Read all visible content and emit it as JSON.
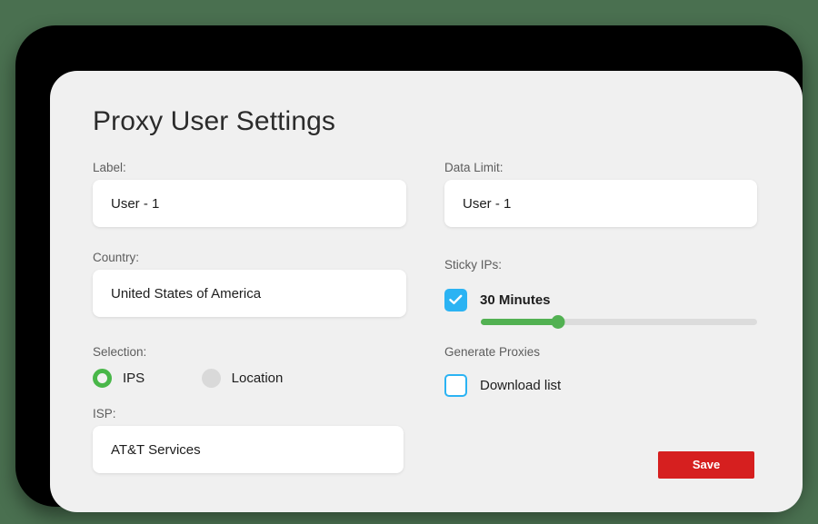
{
  "theme": {
    "page_background": "#4a7050",
    "bezel_color": "#000000",
    "panel_background": "#f0f0f0",
    "accent_green": "#52b152",
    "accent_blue": "#2bb3f3",
    "save_red": "#d61f1f",
    "input_background": "#ffffff",
    "label_color": "#5d5d5d",
    "value_color": "#1d1d1d"
  },
  "title": "Proxy User Settings",
  "left_column": {
    "label_field": {
      "label": "Label:",
      "value": "User - 1",
      "placeholder": "User - 1"
    },
    "country_field": {
      "label": "Country:",
      "value": "United States of America",
      "placeholder": "United States of America"
    },
    "selection": {
      "label": "Selection:",
      "options": [
        {
          "label": "IPS",
          "selected": true
        },
        {
          "label": "Location",
          "selected": false
        }
      ]
    },
    "isp_field": {
      "label": "ISP:",
      "value": "AT&T Services",
      "placeholder": "AT&T Services"
    }
  },
  "right_column": {
    "data_limit_field": {
      "label": "Data Limit:",
      "value": "User - 1",
      "placeholder": "User - 1"
    },
    "sticky_ips": {
      "label": "Sticky IPs:",
      "checkbox_checked": true,
      "duration_text": "30 Minutes",
      "slider": {
        "percent": 28,
        "min": 0,
        "max": 100
      }
    },
    "generate_proxies": {
      "label": "Generate Proxies",
      "checkbox_checked": false,
      "checkbox_text": "Download list"
    },
    "save_button": {
      "label": "Save"
    }
  },
  "icons": {
    "checkmark": "check-icon",
    "radio_selected": "radio-selected-icon",
    "radio_unselected": "radio-unselected-icon",
    "slider_thumb": "slider-thumb-icon"
  }
}
